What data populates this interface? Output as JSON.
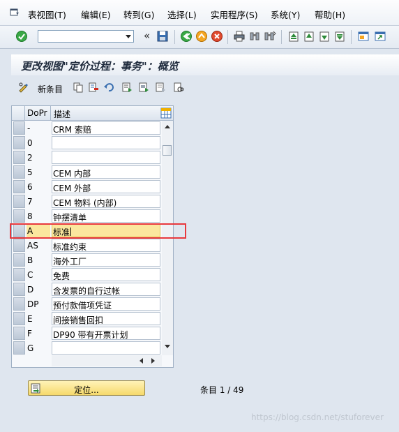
{
  "menu": {
    "items": [
      "表视图(T)",
      "编辑(E)",
      "转到(G)",
      "选择(L)",
      "实用程序(S)",
      "系统(Y)",
      "帮助(H)"
    ]
  },
  "toolbar": {
    "command_value": "",
    "icons": [
      "enter-icon",
      "save-icon",
      "back-icon",
      "exit-icon",
      "cancel-icon",
      "print-icon",
      "find-icon",
      "find-next-icon",
      "first-page-icon",
      "previous-page-icon",
      "next-page-icon",
      "last-page-icon",
      "create-session-icon",
      "shortcut-icon"
    ]
  },
  "title": "更改视图\"定价过程：事务\"：概览",
  "app_toolbar": {
    "new_entries_label": "新条目",
    "icons": [
      "display-change-icon",
      "copy-icon",
      "delete-icon",
      "undo-icon",
      "select-all-icon",
      "select-block-icon",
      "deselect-all-icon",
      "other-view-icon"
    ]
  },
  "table": {
    "columns": [
      "DoPr",
      "描述"
    ],
    "rows": [
      {
        "code": "-",
        "desc": "CRM 索赔"
      },
      {
        "code": "0",
        "desc": ""
      },
      {
        "code": "2",
        "desc": ""
      },
      {
        "code": "5",
        "desc": "CEM 内部"
      },
      {
        "code": "6",
        "desc": "CEM 外部"
      },
      {
        "code": "7",
        "desc": "CEM 物料 (内部)"
      },
      {
        "code": "8",
        "desc": "钟摆清单"
      },
      {
        "code": "A",
        "desc": "标准"
      },
      {
        "code": "AS",
        "desc": "标准约束"
      },
      {
        "code": "B",
        "desc": "海外工厂"
      },
      {
        "code": "C",
        "desc": "免费"
      },
      {
        "code": "D",
        "desc": "含发票的自行过帐"
      },
      {
        "code": "DP",
        "desc": "预付款借项凭证"
      },
      {
        "code": "E",
        "desc": "间接销售回扣"
      },
      {
        "code": "F",
        "desc": "DP90 带有开票计划"
      },
      {
        "code": "G",
        "desc": ""
      }
    ],
    "highlighted_code": "A"
  },
  "position_button_label": "定位...",
  "entry_count": "条目 1 / 49",
  "watermark": "https://blog.csdn.net/stuforever",
  "colors": {
    "background": "#dfe6ef",
    "highlight_row": "#fbe79e",
    "annotation": "#e8383d",
    "button": "#f6d96b"
  }
}
